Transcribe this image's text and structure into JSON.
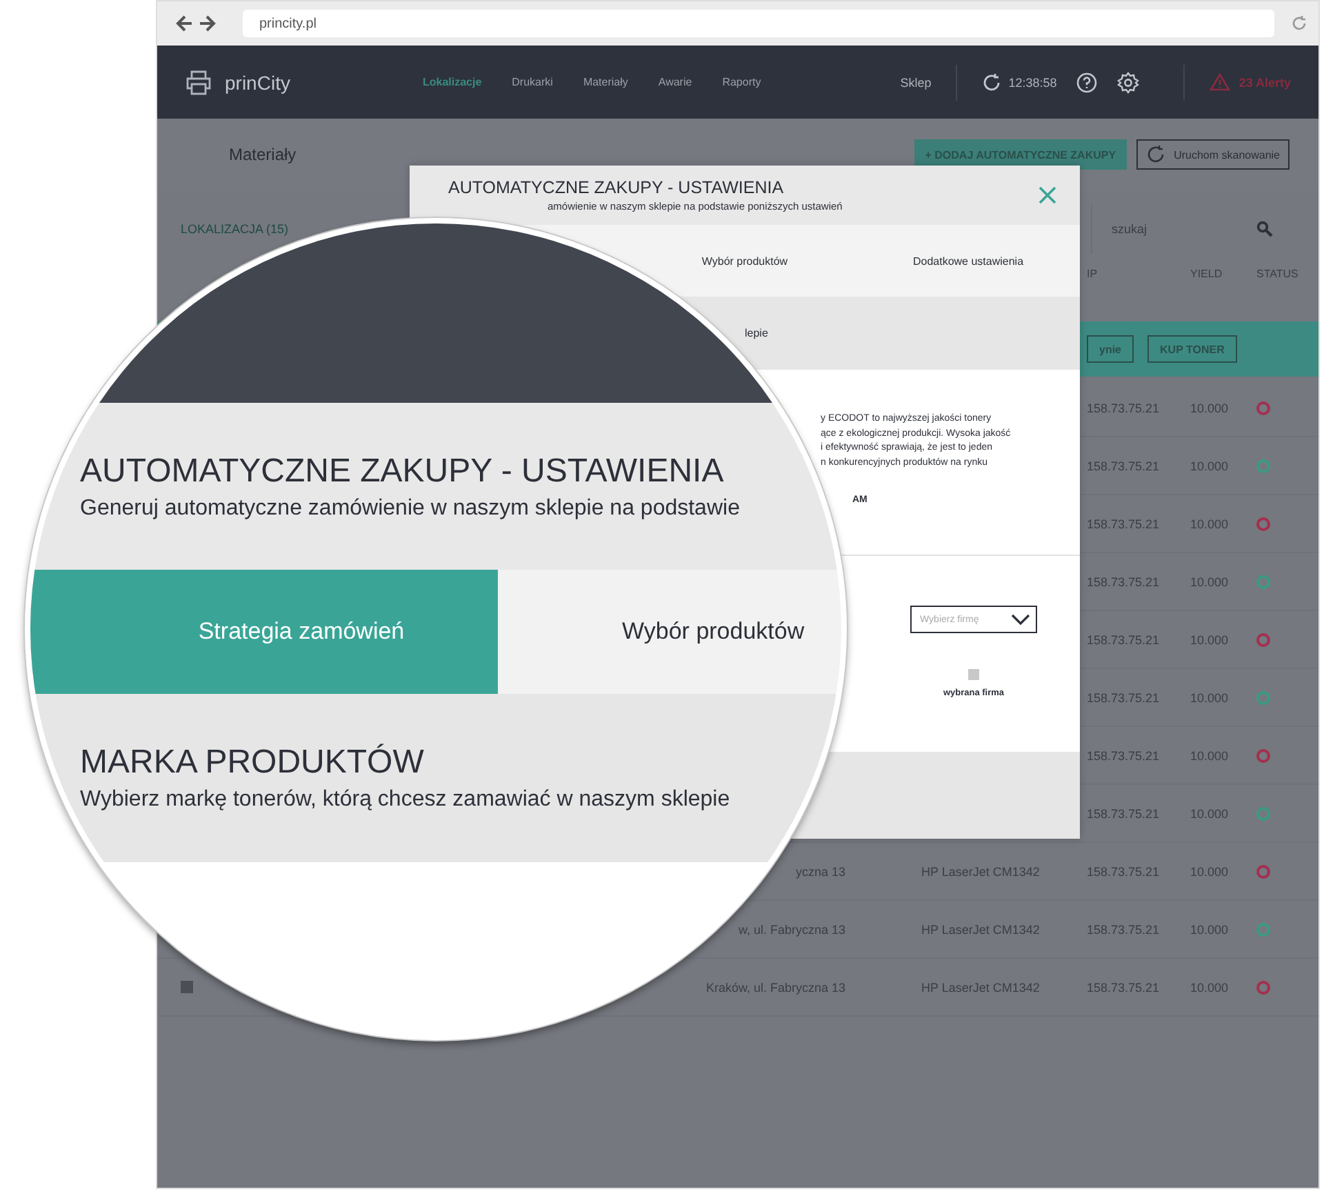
{
  "browser": {
    "url": "princity.pl"
  },
  "nav": {
    "brand": "prinCity",
    "links": [
      {
        "label": "Lokalizacje",
        "selected": true
      },
      {
        "label": "Drukarki",
        "selected": false
      },
      {
        "label": "Materiały",
        "selected": false
      },
      {
        "label": "Awarie",
        "selected": false
      },
      {
        "label": "Raporty",
        "selected": false
      }
    ],
    "shop": "Sklep",
    "time": "12:38:58",
    "alerts": "23 Alerty"
  },
  "page": {
    "title": "Materiały",
    "add_button": "+ DODAJ AUTOMATYCZNE ZAKUPY",
    "scan_button": "Uruchom skanowanie",
    "location_label": "LOKALIZACJA (15)",
    "search": {
      "placeholder": "szukaj"
    }
  },
  "table": {
    "columns": [
      "IP",
      "YIELD",
      "STATUS"
    ],
    "rows": [
      {
        "selected": true,
        "actions": [
          "ynie",
          "KUP TONER"
        ]
      },
      {
        "selected": false,
        "ip": "158.73.75.21",
        "yield": "10.000",
        "color": "#a3304f"
      },
      {
        "selected": false,
        "ip": "158.73.75.21",
        "yield": "10.000",
        "color": "#3b9a86"
      },
      {
        "selected": false,
        "ip": "158.73.75.21",
        "yield": "10.000",
        "color": "#a3304f"
      },
      {
        "selected": false,
        "ip": "158.73.75.21",
        "yield": "10.000",
        "color": "#3b9a86"
      },
      {
        "selected": false,
        "ip": "158.73.75.21",
        "yield": "10.000",
        "color": "#a3304f"
      },
      {
        "selected": false,
        "ip": "158.73.75.21",
        "yield": "10.000",
        "color": "#3b9a86"
      },
      {
        "selected": false,
        "ip": "158.73.75.21",
        "yield": "10.000",
        "color": "#a3304f"
      },
      {
        "selected": false,
        "ip": "158.73.75.21",
        "yield": "10.000",
        "color": "#3b9a86"
      },
      {
        "selected": false,
        "address": "yczna 13",
        "model": "HP LaserJet CM1342",
        "ip": "158.73.75.21",
        "yield": "10.000",
        "color": "#a3304f"
      },
      {
        "selected": false,
        "address": "w, ul. Fabryczna 13",
        "model": "HP LaserJet CM1342",
        "ip": "158.73.75.21",
        "yield": "10.000",
        "color": "#3b9a86"
      },
      {
        "selected": false,
        "checked": false,
        "address": "Kraków, ul. Fabryczna 13",
        "model": "HP LaserJet CM1342",
        "ip": "158.73.75.21",
        "yield": "10.000",
        "color": "#a3304f"
      }
    ]
  },
  "modal": {
    "title": "AUTOMATYCZNE ZAKUPY - USTAWIENIA",
    "subtitle": "amówienie w naszym sklepie na podstawie poniższych ustawień",
    "tabs": [
      {
        "label": "Wybór produktów",
        "selected": false
      },
      {
        "label": "Dodatkowe ustawienia",
        "selected": false
      }
    ],
    "section_text": "lepie",
    "description_lines": [
      "y ECODOT to najwyższej jakości tonery",
      "ące z ekologicznej produkcji. Wysoka jakość",
      "i efektywność sprawiają, że jest to jeden",
      "n konkurencyjnych produktów na rynku"
    ],
    "badge_fragment": "AM",
    "brand_select": {
      "placeholder": "Wybierz firmę"
    },
    "selected_brand_label": "wybrana firma"
  },
  "magnifier": {
    "title": "AUTOMATYCZNE ZAKUPY - USTAWIENIA",
    "subtitle": "Generuj automatyczne zamówienie w naszym sklepie na podstawie",
    "tabs": [
      {
        "label": "Strategia zamówień",
        "selected": true
      },
      {
        "label": "Wybór produktów",
        "selected": false
      }
    ],
    "section_title": "MARKA PRODUKTÓW",
    "section_subtitle": "Wybierz markę tonerów, którą chcesz zamawiać w naszym sklepie"
  }
}
